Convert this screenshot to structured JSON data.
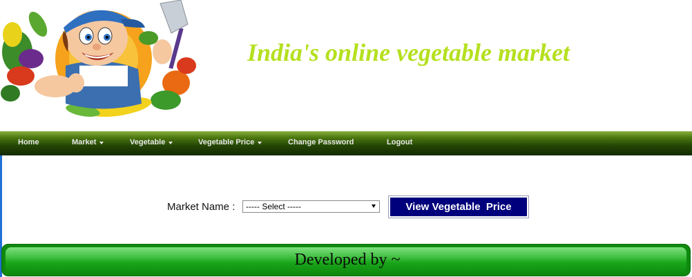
{
  "header": {
    "site_title": "India's online vegetable market"
  },
  "nav": {
    "items": [
      {
        "label": "Home",
        "has_dropdown": false
      },
      {
        "label": "Market",
        "has_dropdown": true
      },
      {
        "label": "Vegetable",
        "has_dropdown": true
      },
      {
        "label": "Vegetable Price",
        "has_dropdown": true
      },
      {
        "label": "Change Password",
        "has_dropdown": false
      },
      {
        "label": "Logout",
        "has_dropdown": false
      }
    ]
  },
  "form": {
    "market_label": "Market Name :",
    "market_select_value": "----- Select -----",
    "view_button_label": "View Vegetable  Price"
  },
  "footer": {
    "text": "Developed by ~"
  },
  "colors": {
    "title": "#b5e01f",
    "button_bg": "#00007c",
    "footer_green": "#1aa51a",
    "nav_dark": "#234505"
  }
}
